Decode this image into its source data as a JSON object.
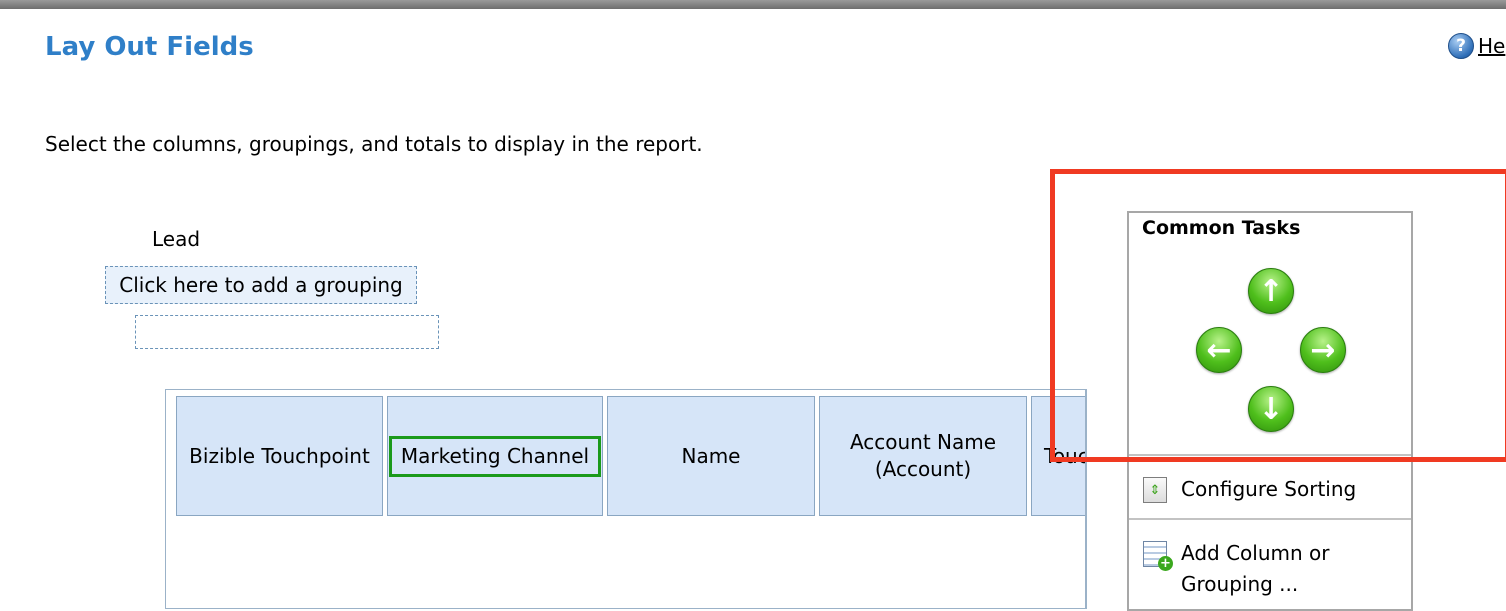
{
  "header": {
    "title": "Lay Out Fields",
    "help_label": "He",
    "help_icon_glyph": "?"
  },
  "instructions": "Select the columns, groupings, and totals to display in the report.",
  "grouping": {
    "label": "Lead",
    "add_grouping_label": "Click here to add a grouping"
  },
  "columns": [
    {
      "label": "Bizible Touchpoint",
      "selected": false
    },
    {
      "label": "Marketing Channel",
      "selected": true
    },
    {
      "label": "Name",
      "selected": false
    },
    {
      "label": "Account Name\n(Account)",
      "selected": false
    },
    {
      "label": "Touc",
      "selected": false
    }
  ],
  "common_tasks": {
    "title": "Common Tasks",
    "arrows": {
      "up_icon": "arrow-up-icon",
      "left_icon": "arrow-left-icon",
      "right_icon": "arrow-right-icon",
      "down_icon": "arrow-down-icon"
    },
    "items": [
      {
        "label": "Configure Sorting",
        "icon": "sort-icon"
      },
      {
        "label": "Add Column or Grouping ...",
        "icon": "add-column-icon"
      }
    ]
  },
  "colors": {
    "title": "#2f7fc8",
    "column_header_bg": "#d6e5f8",
    "selected_outline": "#1b9a1b",
    "highlight": "#f03a22"
  }
}
